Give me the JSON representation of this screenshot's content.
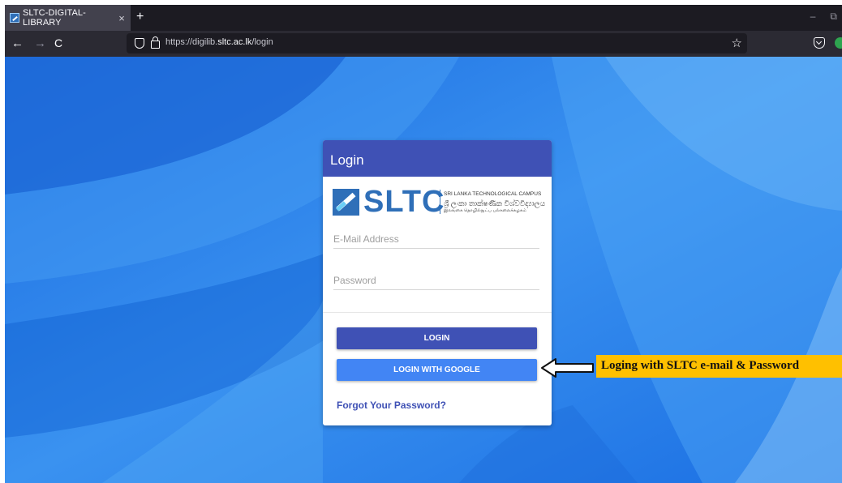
{
  "browser": {
    "tab_title": "SLTC-DIGITAL-LIBRARY",
    "tab_close": "×",
    "new_tab": "+",
    "minimize": "–",
    "restore": "⧉",
    "back": "←",
    "forward": "→",
    "reload": "C",
    "url_prefix": "https://digilib.",
    "url_domain": "sltc.ac.lk",
    "url_path": "/login",
    "bookmark_star": "☆",
    "icons": [
      "favicon-icon",
      "close-icon",
      "plus-icon",
      "back-arrow-icon",
      "forward-arrow-icon",
      "reload-icon",
      "shield-icon",
      "lock-icon",
      "star-icon",
      "pocket-icon",
      "extension-icon"
    ]
  },
  "login": {
    "header_title": "Login",
    "logo": {
      "wordmark": "SLTC",
      "line1": "SRI LANKA TECHNOLOGICAL CAMPUS",
      "line2": "ශ්‍රී ලංකා තාක්ෂණික විශ්වවිද්‍යාලය",
      "line3": "இலங்கை தொழில்நுட்ப பல்கலைக்கழகம்"
    },
    "email_placeholder": "E-Mail Address",
    "email_value": "",
    "password_placeholder": "Password",
    "password_value": "",
    "login_button": "LOGIN",
    "google_button": "LOGIN WITH GOOGLE",
    "forgot_link": "Forgot Your Password?"
  },
  "annotation": {
    "text": "Loging with SLTC e-mail & Password",
    "background": "#ffc000"
  },
  "colors": {
    "header": "#3f51b5",
    "login_button": "#3f51b5",
    "google_button": "#4285f4",
    "page_background": "#1d72e0"
  }
}
